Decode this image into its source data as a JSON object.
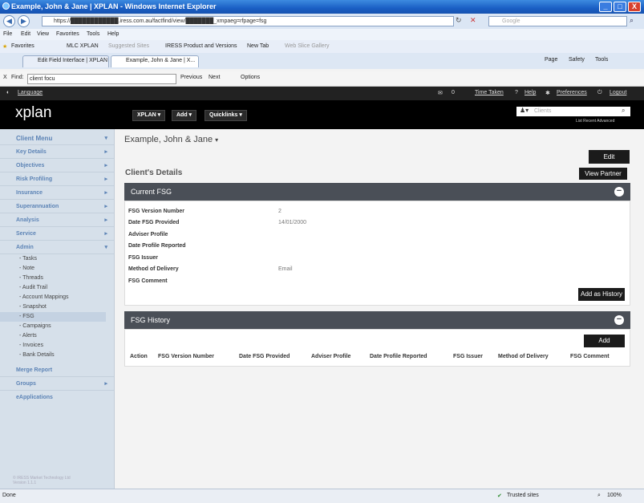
{
  "window": {
    "title": "Example, John & Jane | XPLAN - Windows Internet Explorer",
    "controls": [
      "_",
      "□",
      "X"
    ]
  },
  "browser": {
    "address": "https://████████████.iress.com.au/factfind/view/███████_xmpaeg=rfpage=fsg",
    "search_placeholder": "Google",
    "menu": [
      "File",
      "Edit",
      "View",
      "Favorites",
      "Tools",
      "Help"
    ],
    "favorites_label": "Favorites",
    "favorites": [
      "MLC XPLAN",
      "Suggested Sites",
      "IRESS Product and Versions",
      "New Tab",
      "Web Slice Gallery"
    ],
    "tabs": [
      "Edit Field Interface | XPLAN",
      "Example, John & Jane | X..."
    ],
    "toolbar_right": [
      "Page",
      "Safety",
      "Tools"
    ],
    "find_label": "Find:",
    "find_value": "client focu",
    "find_prev": "Previous",
    "find_next": "Next",
    "find_options": "Options",
    "find_close": "X"
  },
  "app": {
    "top_links": [
      "Language",
      "Time Taken",
      "Help",
      "Preferences",
      "Logout"
    ],
    "message_count": "0",
    "logo": "xplan",
    "nav_buttons": [
      "XPLAN",
      "Add",
      "Quicklinks"
    ],
    "client_search_placeholder": "Clients",
    "search_links": "List  Recent  Advanced"
  },
  "sidebar": {
    "header": "Client Menu",
    "items": [
      "Key Details",
      "Objectives",
      "Risk Profiling",
      "Insurance",
      "Superannuation",
      "Analysis",
      "Service",
      "Admin"
    ],
    "admin_sub": [
      "- Tasks",
      "- Note",
      "- Threads",
      "- Audit Trail",
      "- Account Mappings",
      "- Snapshot",
      "- FSG",
      "- Campaigns",
      "- Alerts",
      "- Invoices",
      "- Bank Details"
    ],
    "bottom_items": [
      "Merge Report",
      "Groups",
      "eApplications"
    ],
    "footer_line1": "© IRESS Market Technology Ltd",
    "footer_line2": "Version 1.1.1"
  },
  "main": {
    "client_name": "Example, John & Jane",
    "edit_button": "Edit",
    "view_partner_button": "View Partner",
    "section_title": "Client's Details",
    "current_fsg": {
      "header": "Current FSG",
      "fields": [
        {
          "label": "FSG Version Number",
          "value": "2"
        },
        {
          "label": "Date FSG Provided",
          "value": "14/01/2000"
        },
        {
          "label": "Adviser Profile",
          "value": ""
        },
        {
          "label": "Date Profile Reported",
          "value": ""
        },
        {
          "label": "FSG Issuer",
          "value": ""
        },
        {
          "label": "Method of Delivery",
          "value": "Email"
        },
        {
          "label": "FSG Comment",
          "value": ""
        }
      ],
      "add_history_button": "Add as History"
    },
    "fsg_history": {
      "header": "FSG History",
      "add_button": "Add",
      "columns": [
        "Action",
        "FSG Version Number",
        "Date FSG Provided",
        "Adviser Profile",
        "Date Profile Reported",
        "FSG Issuer",
        "Method of Delivery",
        "FSG Comment"
      ]
    }
  },
  "status": {
    "left": "Done",
    "zone": "Trusted sites",
    "zoom": "100%"
  }
}
